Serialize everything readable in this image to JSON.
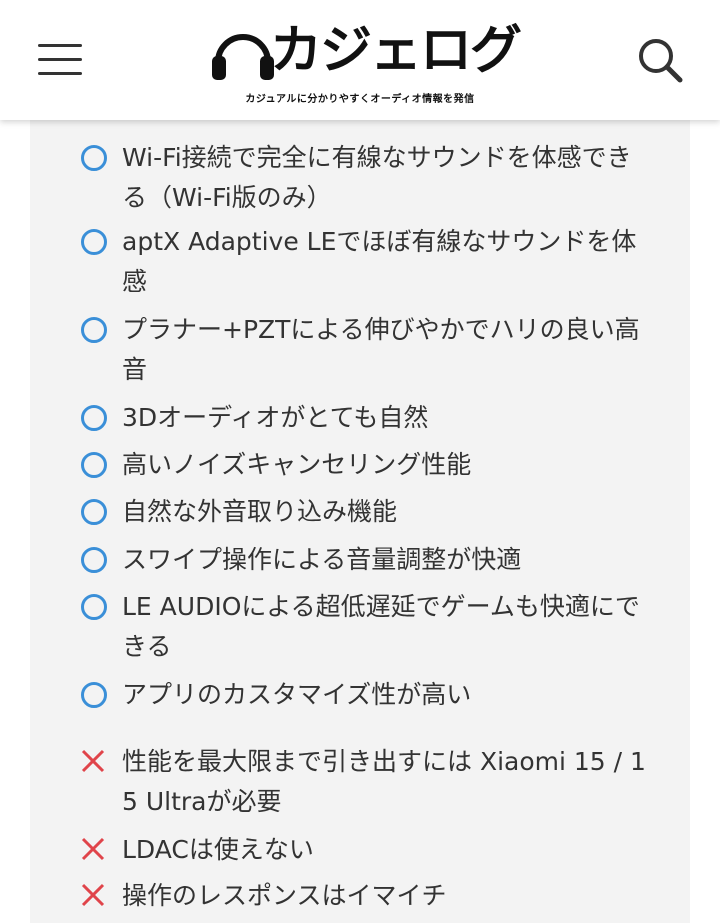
{
  "header": {
    "logo_text": "カジェログ",
    "tagline": "カジュアルに分かりやすくオーディオ情報を発信",
    "menu_icon": "hamburger-menu-icon",
    "search_icon": "search-icon"
  },
  "pros": [
    {
      "label": "Wi-Fi接続で完全に有線なサウンドを体感できる（Wi-Fi版のみ）"
    },
    {
      "label": "aptX Adaptive LEでほぼ有線なサウンドを体感"
    },
    {
      "label": "プラナー+PZTによる伸びやかでハリの良い高音"
    },
    {
      "label": "3Dオーディオがとても自然"
    },
    {
      "label": "高いノイズキャンセリング性能"
    },
    {
      "label": "自然な外音取り込み機能"
    },
    {
      "label": "スワイプ操作による音量調整が快適"
    },
    {
      "label": "LE AUDIOによる超低遅延でゲームも快適にできる"
    },
    {
      "label": "アプリのカスタマイズ性が高い"
    }
  ],
  "cons": [
    {
      "label": "性能を最大限まで引き出すには Xiaomi 15 / 15 Ultraが必要"
    },
    {
      "label": "LDACは使えない"
    },
    {
      "label": "操作のレスポンスはイマイチ"
    }
  ],
  "colors": {
    "pro_mark": "#3a8fd8",
    "con_mark": "#e0444a",
    "box_background": "#f3f3f3",
    "text": "#333333"
  }
}
